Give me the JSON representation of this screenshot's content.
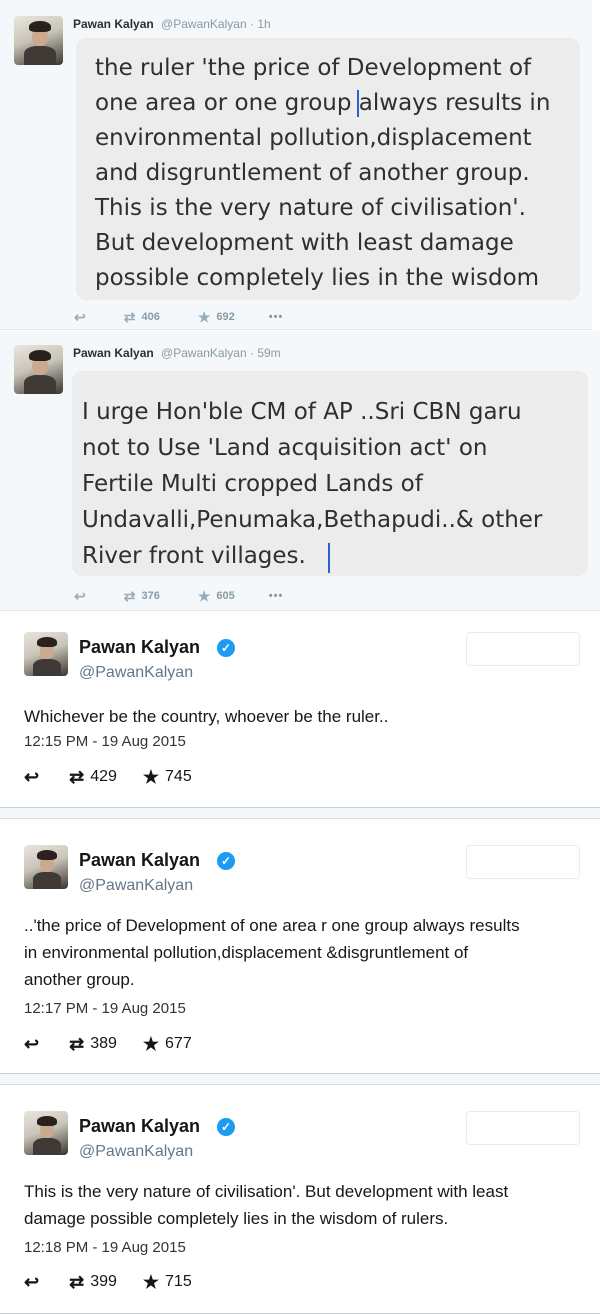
{
  "tweets_old": [
    {
      "name": "Pawan Kalyan",
      "handle": "@PawanKalyan",
      "dot": "·",
      "time": "1h",
      "image_lines": [
        "the ruler 'the price of Development of",
        "one area or one group always results in",
        "environmental pollution,displacement",
        "and disgruntlement of another group.",
        "This is the very nature of civilisation'.",
        "But development with least damage",
        "possible completely lies in the wisdom"
      ],
      "reply_icon": "reply-icon",
      "retweet_icon": "retweet-icon",
      "retweets": "406",
      "favorite_icon": "star-icon",
      "favorites": "692",
      "more": "•••"
    },
    {
      "name": "Pawan Kalyan",
      "handle": "@PawanKalyan",
      "dot": "·",
      "time": "59m",
      "image_lines": [
        "I urge Hon'ble CM of AP ..Sri CBN garu",
        "not to Use 'Land acquisition act' on",
        "Fertile Multi cropped Lands  of",
        "Undavalli,Penumaka,Bethapudi..& other",
        "River front villages."
      ],
      "reply_icon": "reply-icon",
      "retweet_icon": "retweet-icon",
      "retweets": "376",
      "favorite_icon": "star-icon",
      "favorites": "605",
      "more": "•••"
    }
  ],
  "tweets": [
    {
      "name": "Pawan Kalyan",
      "verified": "✓",
      "handle": "@PawanKalyan",
      "lines": [
        "Whichever be the country, whoever be the ruler.."
      ],
      "timestamp": "12:15 PM - 19 Aug 2015",
      "retweets": "429",
      "favorites": "745"
    },
    {
      "name": "Pawan Kalyan",
      "verified": "✓",
      "handle": "@PawanKalyan",
      "lines": [
        "..'the price of Development of one area r one group always results",
        "in environmental pollution,displacement &disgruntlement of",
        "another group."
      ],
      "timestamp": "12:17 PM - 19 Aug 2015",
      "retweets": "389",
      "favorites": "677"
    },
    {
      "name": "Pawan Kalyan",
      "verified": "✓",
      "handle": "@PawanKalyan",
      "lines": [
        "This is the very nature of civilisation'. But development with least",
        "damage possible completely lies in the wisdom of rulers."
      ],
      "timestamp": "12:18 PM - 19 Aug 2015",
      "retweets": "399",
      "favorites": "715"
    }
  ],
  "icons": {
    "reply": "↩",
    "retweet": "⇄",
    "star": "★"
  },
  "colors": {
    "accent_blue": "#1d9bf0",
    "muted": "#8899a6"
  }
}
